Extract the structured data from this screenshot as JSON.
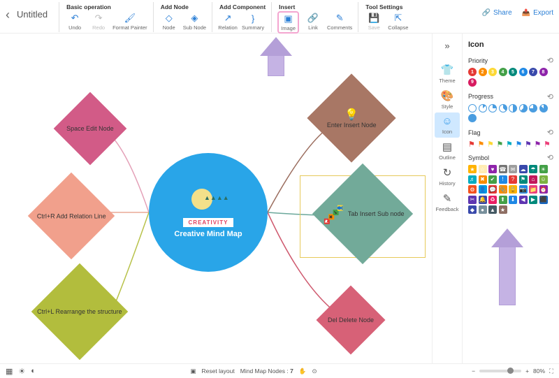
{
  "header": {
    "untitled": "Untitled",
    "share": "Share",
    "export": "Export",
    "groups": [
      {
        "title": "Basic operation",
        "items": [
          {
            "label": "Undo",
            "name": "undo-icon"
          },
          {
            "label": "Redo",
            "name": "redo-icon",
            "disabled": true
          },
          {
            "label": "Format Painter",
            "name": "format-painter-icon"
          }
        ]
      },
      {
        "title": "Add Node",
        "items": [
          {
            "label": "Node",
            "name": "node-icon"
          },
          {
            "label": "Sub Node",
            "name": "subnode-icon"
          }
        ]
      },
      {
        "title": "Add Component",
        "items": [
          {
            "label": "Relation",
            "name": "relation-icon"
          },
          {
            "label": "Summary",
            "name": "summary-icon"
          }
        ]
      },
      {
        "title": "Insert",
        "highlight": true,
        "items": [
          {
            "label": "Image",
            "name": "image-icon",
            "highlight": true
          },
          {
            "label": "Link",
            "name": "link-icon"
          },
          {
            "label": "Comments",
            "name": "comments-icon"
          }
        ]
      },
      {
        "title": "Tool Settings",
        "items": [
          {
            "label": "Save",
            "name": "save-icon",
            "disabled": true
          },
          {
            "label": "Collapse",
            "name": "collapse-icon"
          }
        ]
      }
    ]
  },
  "canvas": {
    "center_banner": "CREATIVITY",
    "center_title": "Creative Mind Map",
    "nodes": {
      "n1": "Space Edit Node",
      "n2": "Ctrl+R Add Relation Line",
      "n3": "Ctrl+L Rearrange the structure",
      "n4": "Enter Insert Node",
      "n5": "Tab Insert Sub node",
      "n6": "Del Delete Node"
    }
  },
  "tabs": {
    "items": [
      {
        "label": "Theme",
        "name": "theme-icon",
        "glyph": "👕"
      },
      {
        "label": "Style",
        "name": "style-icon",
        "glyph": "🎨"
      },
      {
        "label": "Icon",
        "name": "icon-icon",
        "glyph": "☺",
        "active": true
      },
      {
        "label": "Outline",
        "name": "outline-icon",
        "glyph": "▤"
      },
      {
        "label": "History",
        "name": "history-icon",
        "glyph": "↻"
      },
      {
        "label": "Feedback",
        "name": "feedback-icon",
        "glyph": "✎"
      }
    ]
  },
  "panel": {
    "title": "Icon",
    "sections": {
      "priority": {
        "title": "Priority",
        "colors": [
          "#e53935",
          "#fb8c00",
          "#fdd835",
          "#43a047",
          "#00897b",
          "#1e88e5",
          "#3949ab",
          "#8e24aa",
          "#d81b60"
        ]
      },
      "progress": {
        "title": "Progress",
        "count": 9
      },
      "flag": {
        "title": "Flag",
        "colors": [
          "#e53935",
          "#fb8c00",
          "#fdd835",
          "#43a047",
          "#00acc1",
          "#1e88e5",
          "#5e35b1",
          "#8e24aa",
          "#ec407a"
        ]
      },
      "symbol": {
        "title": "Symbol",
        "rows": [
          [
            "#ffb300",
            "#ffecb3",
            "#8e24aa",
            "#757575",
            "#9e9e9e",
            "#3949ab",
            "#00897b",
            "#43a047",
            "#00acc1"
          ],
          [
            "#fb8c00",
            "#43a047",
            "#1e88e5",
            "#e53935",
            "#00897b",
            "#c2185b",
            "#7cb342",
            "#f4511e",
            "#039be5"
          ],
          [
            "#e53935",
            "#fb8c00",
            "#ffb300",
            "#1e88e5",
            "#ec407a",
            "#8e24aa",
            "#5e35b1",
            "#3949ab",
            "#e91e63"
          ],
          [
            "#43a047",
            "#1e88e5",
            "#5e35b1",
            "#00897b",
            "#1565c0",
            "#3949ab",
            "#78909c",
            "#455a64",
            "#8d6e63"
          ]
        ]
      }
    }
  },
  "statusbar": {
    "reset": "Reset layout",
    "nodes_label": "Mind Map Nodes :",
    "nodes_count": "7",
    "zoom": "80%"
  }
}
